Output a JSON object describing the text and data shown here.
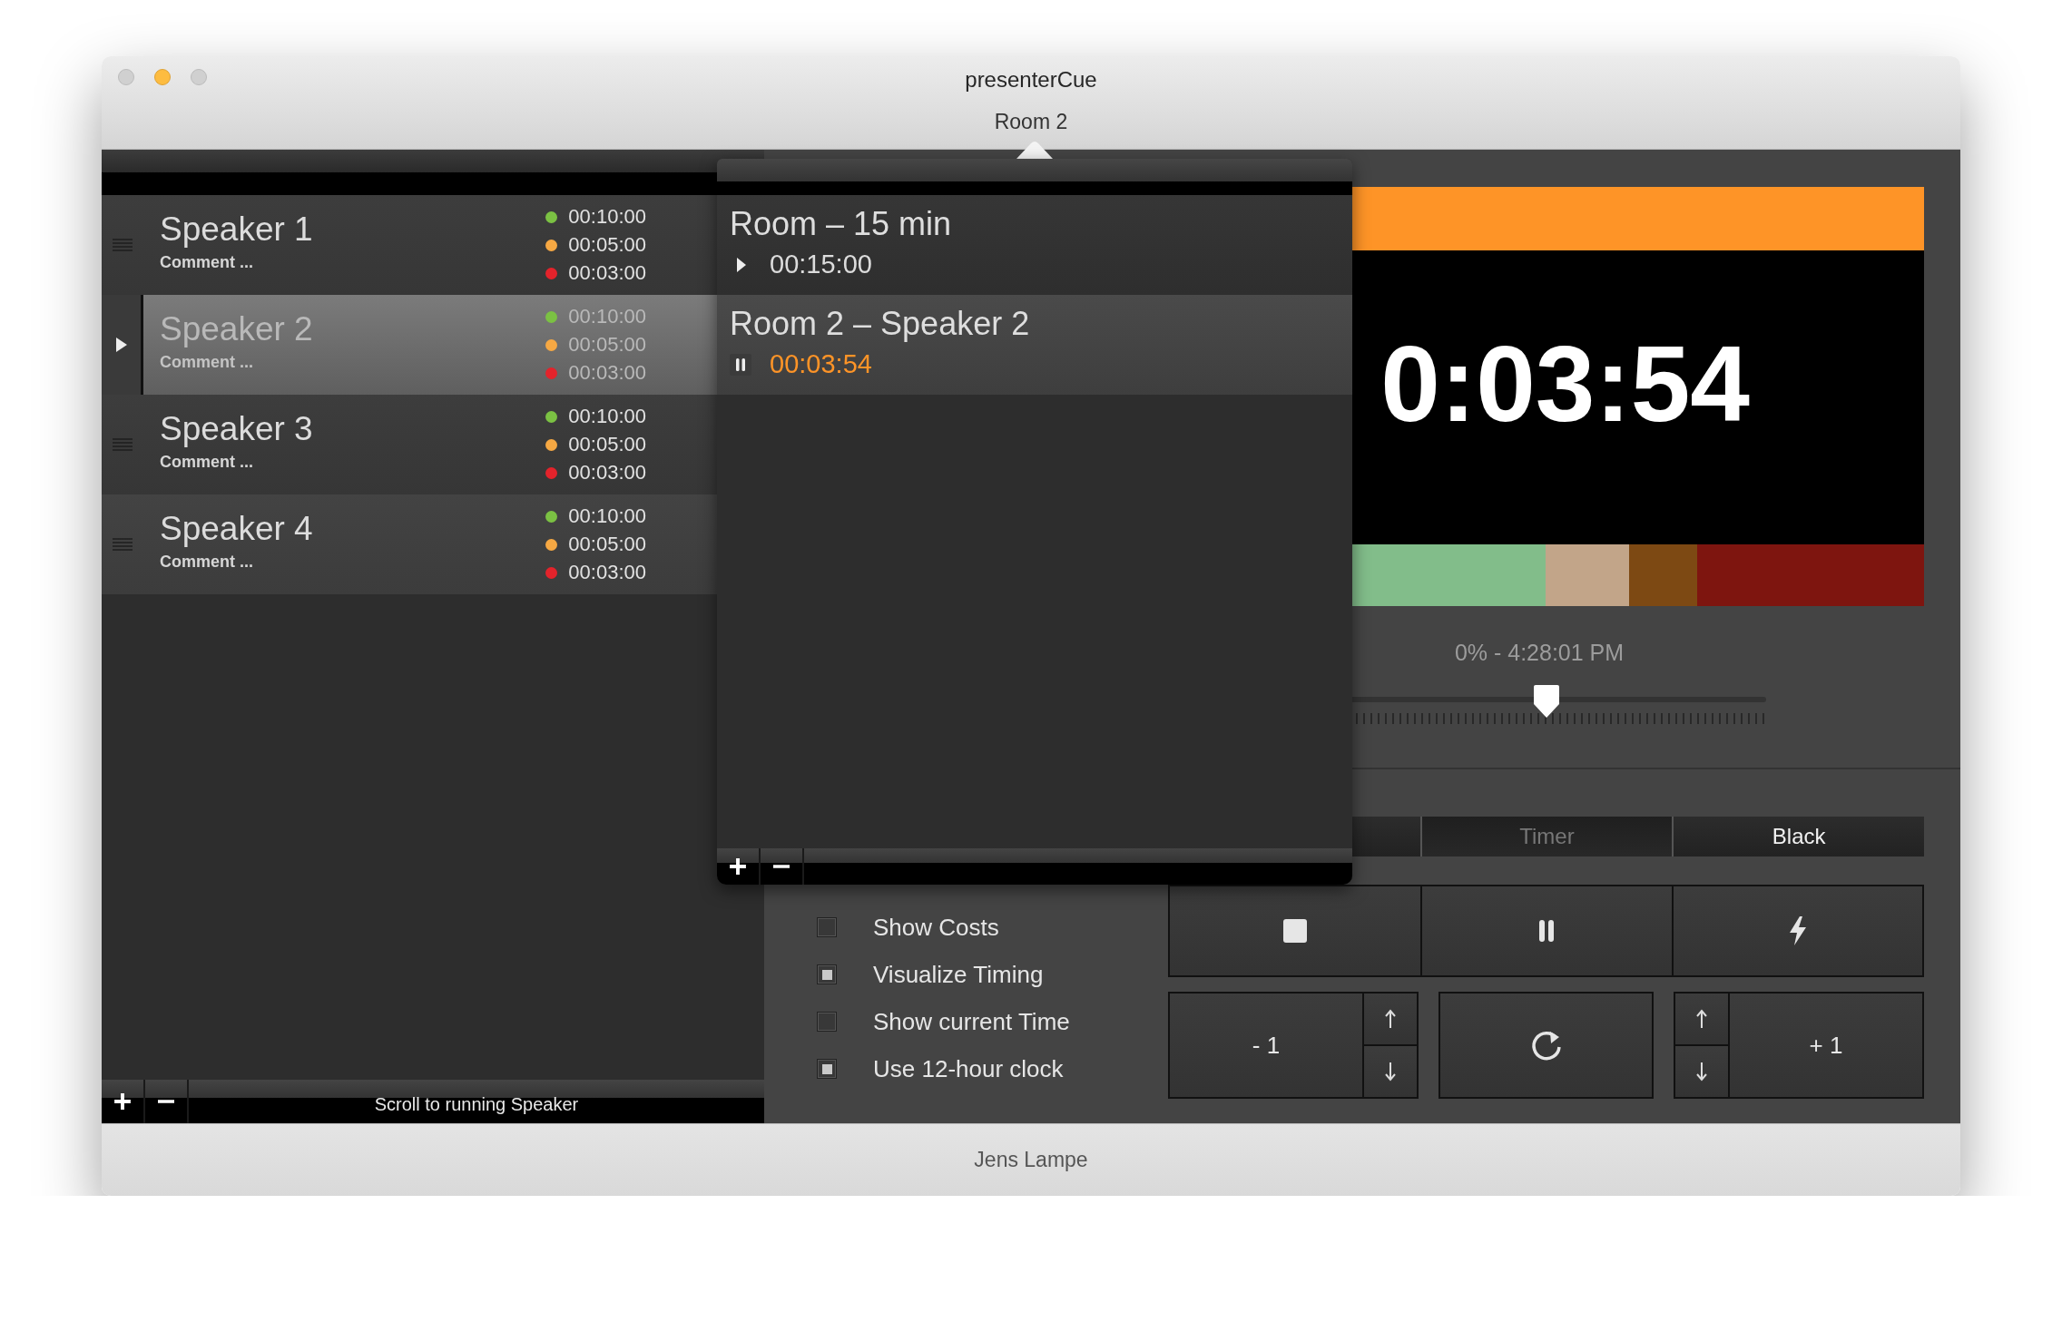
{
  "window": {
    "title": "presenterCue",
    "subtitle": "Room 2",
    "footer": "Jens Lampe"
  },
  "speakers": [
    {
      "name": "Speaker 1",
      "comment": "Comment ...",
      "selected": false,
      "times": [
        {
          "value": "00:10:00",
          "color": "#7bc143"
        },
        {
          "value": "00:05:00",
          "color": "#f6a843"
        },
        {
          "value": "00:03:00",
          "color": "#e3232b"
        }
      ]
    },
    {
      "name": "Speaker 2",
      "comment": "Comment ...",
      "selected": true,
      "times": [
        {
          "value": "00:10:00",
          "color": "#7bc143"
        },
        {
          "value": "00:05:00",
          "color": "#f6a843"
        },
        {
          "value": "00:03:00",
          "color": "#e3232b"
        }
      ]
    },
    {
      "name": "Speaker 3",
      "comment": "Comment ...",
      "selected": false,
      "times": [
        {
          "value": "00:10:00",
          "color": "#7bc143"
        },
        {
          "value": "00:05:00",
          "color": "#f6a843"
        },
        {
          "value": "00:03:00",
          "color": "#e3232b"
        }
      ]
    },
    {
      "name": "Speaker 4",
      "comment": "Comment ...",
      "selected": false,
      "times": [
        {
          "value": "00:10:00",
          "color": "#7bc143"
        },
        {
          "value": "00:05:00",
          "color": "#f6a843"
        },
        {
          "value": "00:03:00",
          "color": "#e3232b"
        }
      ]
    }
  ],
  "scroll_button": "Scroll to running Speaker",
  "rooms": [
    {
      "title": "Room – 15 min",
      "kind": "stopped",
      "time": "00:15:00",
      "selected": false
    },
    {
      "title": "Room 2 – Speaker 2",
      "kind": "running",
      "time": "00:03:54",
      "selected": true
    }
  ],
  "preview": {
    "timer": "0:03:54",
    "bands": [
      {
        "color": "#82bd8a"
      },
      {
        "color": "#c2a589"
      },
      {
        "color": "#7d4913"
      },
      {
        "color": "#7e150f"
      }
    ],
    "status": "0% - 4:28:01 PM"
  },
  "slider": {
    "level": 0.5
  },
  "modes": [
    {
      "label": "Timer",
      "selected": true
    },
    {
      "label": "Black",
      "selected": false
    }
  ],
  "options": [
    {
      "label": "Show Costs",
      "checked": false
    },
    {
      "label": "Visualize Timing",
      "checked": true
    },
    {
      "label": "Show current Time",
      "checked": false
    },
    {
      "label": "Use 12-hour clock",
      "checked": true
    }
  ],
  "steps": {
    "minus": "- 1",
    "plus": "+ 1"
  }
}
